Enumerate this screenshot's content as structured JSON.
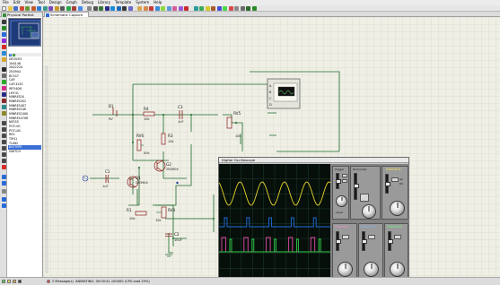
{
  "menu": [
    "File",
    "Edit",
    "View",
    "Tool",
    "Design",
    "Graph",
    "Debug",
    "Library",
    "Template",
    "System",
    "Help"
  ],
  "tabs": [
    {
      "label": "Physical Partlist View",
      "active": false
    },
    {
      "label": "Schematic Capture",
      "active": true
    }
  ],
  "sidepanel": {
    "device_header": {
      "p": "P",
      "l": "L"
    },
    "devices": [
      "DEVICES",
      "1N4148",
      "2N2222A",
      "2N3904",
      "BC547",
      "CAP",
      "CAP-ELEC",
      "IRF540N",
      "LM741",
      "MINRES1K",
      "MINRES2K2",
      "MINRES4K7",
      "MINRES10K",
      "MINRES100K",
      "MINRES470R",
      "NE555",
      "POT-HG",
      "POT-LIN",
      "RES",
      "TIP41",
      "TL082",
      "BATTERY",
      "SWITCH"
    ],
    "selected_index": 21
  },
  "schematic": {
    "B1": "B1",
    "B1_val": "9V",
    "R4": "R4",
    "R4_val": "10k",
    "C3": "C3",
    "C3_val": "1nF",
    "RV6": "RV6",
    "RV6_val": "50k",
    "R3": "R3",
    "R3_val": "10k",
    "RV5": "RV5",
    "RV5_val": "10k",
    "C1": "C1",
    "C1_val": "1uF",
    "Q1": "Q1",
    "Q1_val": "2N3904",
    "G2": "G2",
    "G2_val": "2N3904",
    "R1": "R1",
    "R1_val": "10k",
    "RV3": "RV3",
    "RV3_val": "10k",
    "C2": "C2",
    "C2_val": "10uF",
    "osc_pins": [
      "A",
      "B",
      "C",
      "D"
    ]
  },
  "scope": {
    "title": "Digital Oscilloscope",
    "channel_a": "Channel A",
    "channel_b": "Channel B",
    "channel_c": "Channel C",
    "channel_d": "Channel D",
    "trigger": "Trigger",
    "horizontal": "Horizontal",
    "level": "Level",
    "ac": "AC",
    "dc": "DC",
    "position": "Position",
    "colors": {
      "a": "#e7d92a",
      "b": "#1e6fe0",
      "c": "#e34aa8",
      "d": "#2fcf4a",
      "grid": "#2a4a36",
      "screen": "#060f0a"
    }
  },
  "status": {
    "messages": "2 Message(s)",
    "animating": "ANIMATING: 00:00:41.100000 (CPU load 29%)"
  }
}
